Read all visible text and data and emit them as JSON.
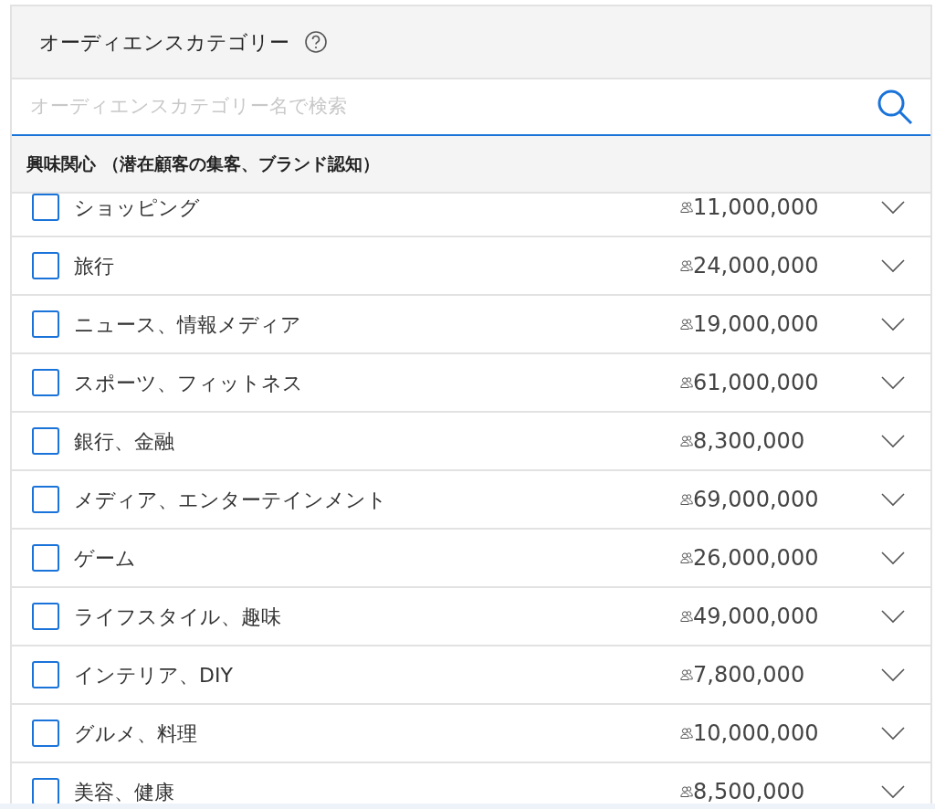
{
  "panel": {
    "title": "オーディエンスカテゴリー",
    "help_icon": true
  },
  "search": {
    "placeholder": "オーディエンスカテゴリー名で検索"
  },
  "section": {
    "title": "興味関心 （潜在顧客の集客、ブランド認知）"
  },
  "categories": [
    {
      "name": "ショッピング",
      "count": "11,000,000",
      "checked": false,
      "expanded": false
    },
    {
      "name": "旅行",
      "count": "24,000,000",
      "checked": false,
      "expanded": false
    },
    {
      "name": "ニュース、情報メディア",
      "count": "19,000,000",
      "checked": false,
      "expanded": false
    },
    {
      "name": "スポーツ、フィットネス",
      "count": "61,000,000",
      "checked": false,
      "expanded": false
    },
    {
      "name": "銀行、金融",
      "count": "8,300,000",
      "checked": false,
      "expanded": false
    },
    {
      "name": "メディア、エンターテインメント",
      "count": "69,000,000",
      "checked": false,
      "expanded": false
    },
    {
      "name": "ゲーム",
      "count": "26,000,000",
      "checked": false,
      "expanded": false
    },
    {
      "name": "ライフスタイル、趣味",
      "count": "49,000,000",
      "checked": false,
      "expanded": false
    },
    {
      "name": "インテリア、DIY",
      "count": "7,800,000",
      "checked": false,
      "expanded": false
    },
    {
      "name": "グルメ、料理",
      "count": "10,000,000",
      "checked": false,
      "expanded": false
    },
    {
      "name": "美容、健康",
      "count": "8,500,000",
      "checked": false,
      "expanded": false
    }
  ]
}
